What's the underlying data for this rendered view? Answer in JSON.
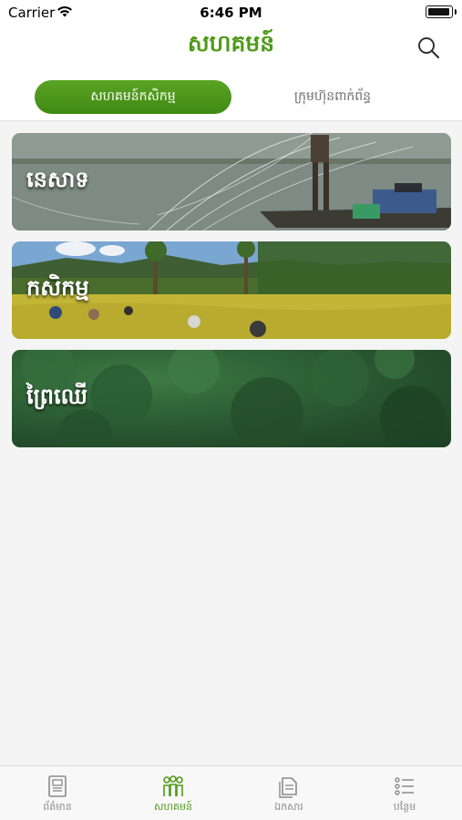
{
  "status_bar": {
    "carrier": "Carrier",
    "time": "6:46 PM"
  },
  "header": {
    "title": "សហគមន៍"
  },
  "segments": {
    "active": "សហគមន៍កសិកម្ម",
    "inactive": "ក្រុមហ៊ុនពាក់ព័ន្ធ"
  },
  "cards": [
    {
      "label": "នេសាទ",
      "image": "fishing-net-photo"
    },
    {
      "label": "កសិកម្ម",
      "image": "rice-field-photo"
    },
    {
      "label": "ព្រៃឈើ",
      "image": "forest-photo"
    }
  ],
  "tabbar": [
    {
      "label": "ព័ត៌មាន",
      "icon": "news-icon"
    },
    {
      "label": "សហគមន៍",
      "icon": "community-icon",
      "active": true
    },
    {
      "label": "ឯកសារ",
      "icon": "documents-icon"
    },
    {
      "label": "បន្ថែម",
      "icon": "more-list-icon"
    }
  ],
  "colors": {
    "accent": "#4e9a16",
    "inactive": "#8a8a8a",
    "background": "#f4f4f4"
  }
}
